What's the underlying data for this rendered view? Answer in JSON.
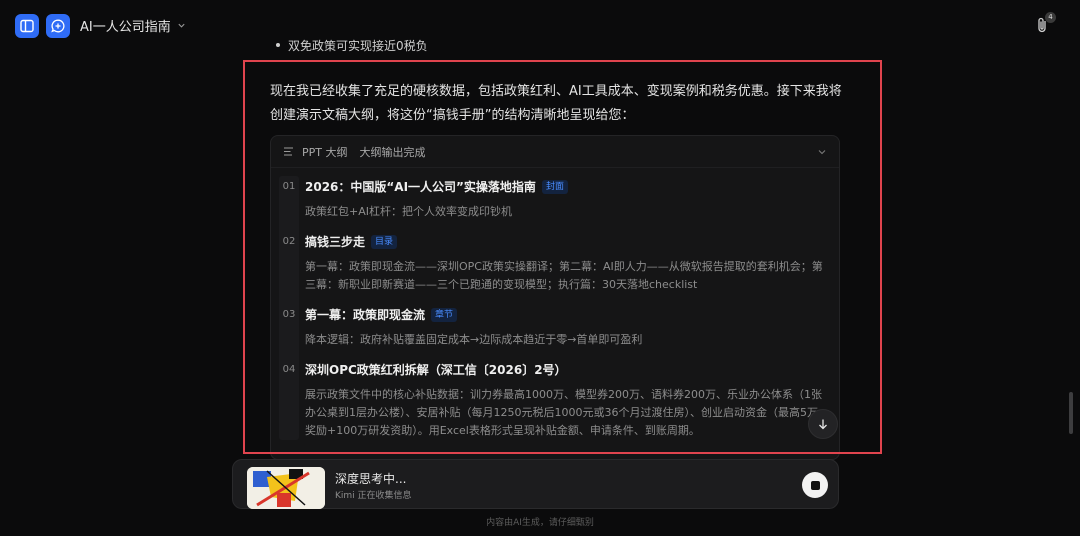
{
  "header": {
    "title": "AI一人公司指南",
    "attachments_count": "4",
    "colors": {
      "accent": "#2f6cf6"
    }
  },
  "chat": {
    "prev_bullet": "双免政策可实现接近0税负",
    "intro": "现在我已经收集了充足的硬核数据，包括政策红利、AI工具成本、变现案例和税务优惠。接下来我将创建演示文稿大纲，将这份“搞钱手册”的结构清晰地呈现给您：",
    "outline": {
      "label": "PPT 大纲",
      "status": "大纲输出完成",
      "items": [
        {
          "num": "01",
          "title": "2026：中国版“AI一人公司”实操落地指南",
          "tag": "封面",
          "desc": "政策红包+AI杠杆：把个人效率变成印钞机"
        },
        {
          "num": "02",
          "title": "搞钱三步走",
          "tag": "目录",
          "desc": "第一幕：政策即现金流——深圳OPC政策实操翻译；第二幕：AI即人力——从微软报告提取的套利机会；第三幕：新职业即新赛道——三个已跑通的变现模型；执行篇：30天落地checklist"
        },
        {
          "num": "03",
          "title": "第一幕：政策即现金流",
          "tag": "章节",
          "desc": "降本逻辑：政府补贴覆盖固定成本→边际成本趋近于零→首单即可盈利"
        },
        {
          "num": "04",
          "title": "深圳OPC政策红利拆解（深工信〔2026〕2号）",
          "tag": "",
          "desc": "展示政策文件中的核心补贴数据：训力券最高1000万、模型券200万、语料券200万、乐业办公体系（1张办公桌到1层办公楼）、安居补贴（每月1250元税后1000元或36个月过渡住房）、创业启动资金（最高5万奖励+100万研发资助）。用Excel表格形式呈现补贴金额、申请条件、到账周期。"
        }
      ]
    }
  },
  "status": {
    "title": "深度思考中...",
    "subtitle": "Kimi 正在收集信息"
  },
  "footer": {
    "note": "内容由AI生成，请仔细甄别"
  }
}
